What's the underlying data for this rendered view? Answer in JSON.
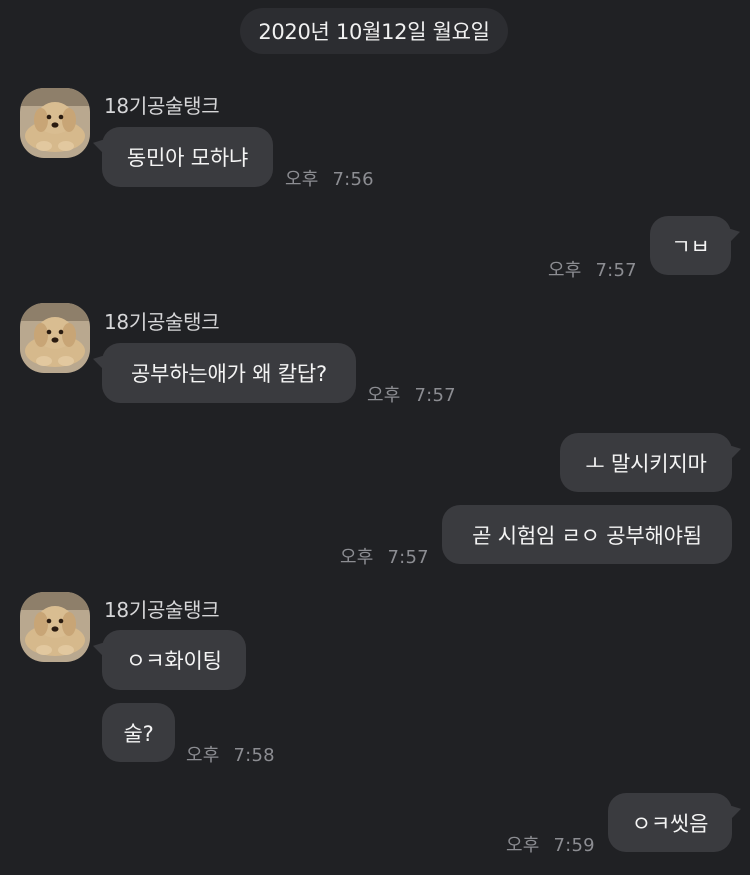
{
  "date_divider": "2020년 10월12일 월요일",
  "sender_name": "18기공술탱크",
  "messages": [
    {
      "text": "동민아 모하냐",
      "ampm": "오후",
      "time": "7:56"
    },
    {
      "text": "ㄱㅂ",
      "ampm": "오후",
      "time": "7:57"
    },
    {
      "text": "공부하는애가 왜 칼답?",
      "ampm": "오후",
      "time": "7:57"
    },
    {
      "text": "ㅗ 말시키지마"
    },
    {
      "text": "곧 시험임 ㄹㅇ 공부해야됨",
      "ampm": "오후",
      "time": "7:57"
    },
    {
      "text": "ㅇㅋ화이팅"
    },
    {
      "text": "술?",
      "ampm": "오후",
      "time": "7:58"
    },
    {
      "text": "ㅇㅋ씻음",
      "ampm": "오후",
      "time": "7:59"
    }
  ],
  "colors": {
    "background": "#202124",
    "bubble": "#3a3b3f",
    "timestamp": "#8c8d92",
    "date_pill": "#2c2d31"
  },
  "icons": {
    "avatar": "golden-retriever-avatar-icon"
  }
}
